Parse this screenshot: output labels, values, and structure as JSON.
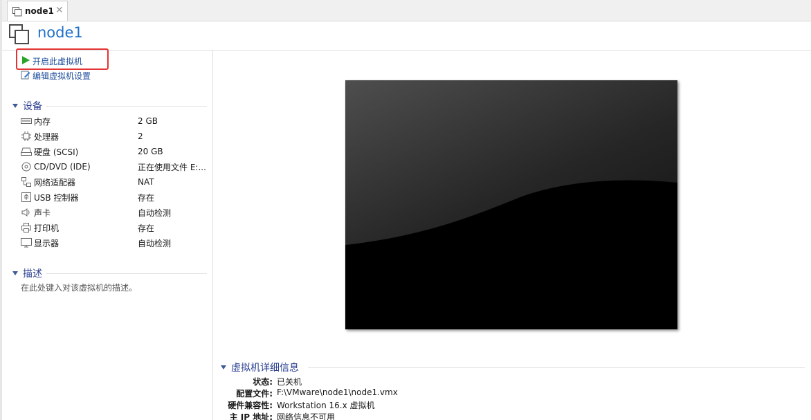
{
  "tab": {
    "label": "node1",
    "close_glyph": "✕",
    "icon": "vm-tab-icon"
  },
  "header": {
    "title": "node1",
    "icon": "vm-icon"
  },
  "actions": [
    {
      "label": "开启此虚拟机",
      "icon": "play-icon"
    },
    {
      "label": "编辑虚拟机设置",
      "icon": "edit-settings-icon"
    }
  ],
  "devices": {
    "title": "设备",
    "items": [
      {
        "name": "内存",
        "value": "2 GB",
        "icon": "memory-icon"
      },
      {
        "name": "处理器",
        "value": "2",
        "icon": "cpu-icon"
      },
      {
        "name": "硬盘 (SCSI)",
        "value": "20 GB",
        "icon": "hard-disk-icon"
      },
      {
        "name": "CD/DVD (IDE)",
        "value": "正在使用文件 E:...",
        "icon": "cd-dvd-icon"
      },
      {
        "name": "网络适配器",
        "value": "NAT",
        "icon": "network-adapter-icon"
      },
      {
        "name": "USB 控制器",
        "value": "存在",
        "icon": "usb-icon"
      },
      {
        "name": "声卡",
        "value": "自动检测",
        "icon": "speaker-icon"
      },
      {
        "name": "打印机",
        "value": "存在",
        "icon": "printer-icon"
      },
      {
        "name": "显示器",
        "value": "自动检测",
        "icon": "monitor-icon"
      }
    ]
  },
  "description": {
    "title": "描述",
    "placeholder": "在此处键入对该虚拟机的描述。"
  },
  "details": {
    "title": "虚拟机详细信息",
    "rows": [
      {
        "key": "状态:",
        "value": "已关机"
      },
      {
        "key": "配置文件:",
        "value": "F:\\VMware\\node1\\node1.vmx"
      },
      {
        "key": "硬件兼容性:",
        "value": "Workstation 16.x 虚拟机"
      },
      {
        "key": "主 IP 地址:",
        "value": "网络信息不可用"
      }
    ]
  },
  "colors": {
    "accent": "#1e6fc8",
    "play": "#2aa52a",
    "highlight": "#e53333",
    "section": "#2a3f8f"
  }
}
